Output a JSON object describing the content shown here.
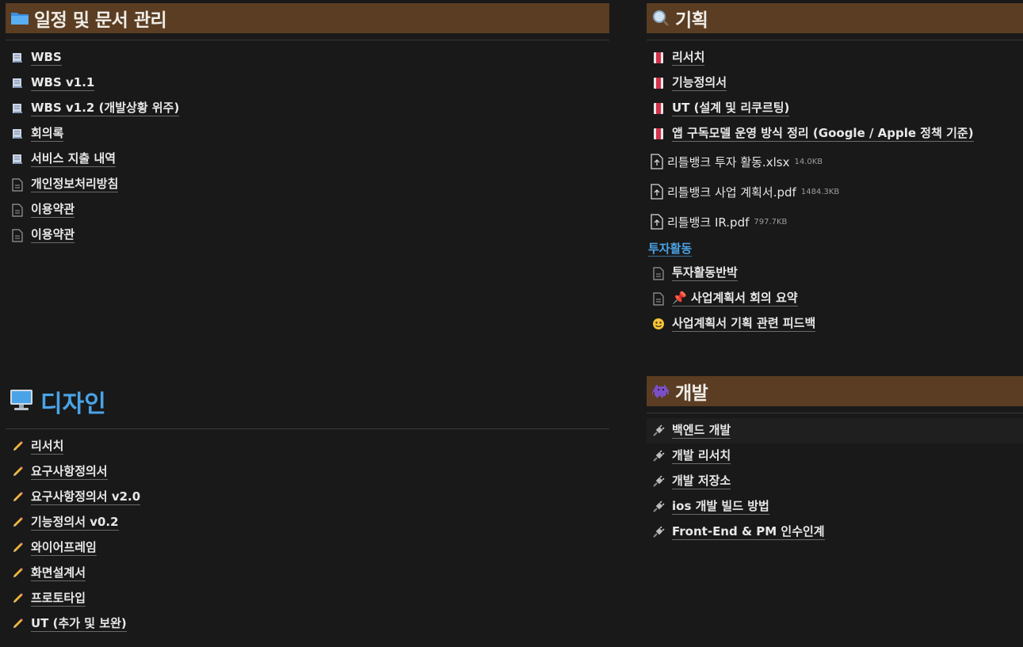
{
  "schedule": {
    "title": "일정 및 문서 관리",
    "items": [
      {
        "label": "WBS",
        "icon": "book-page-icon"
      },
      {
        "label": "WBS v1.1",
        "icon": "book-page-icon"
      },
      {
        "label": "WBS v1.2 (개발상황 위주)",
        "icon": "book-page-icon"
      },
      {
        "label": "회의록",
        "icon": "book-page-icon"
      },
      {
        "label": "서비스 지출 내역",
        "icon": "book-page-icon"
      },
      {
        "label": "개인정보처리방침",
        "icon": "page-icon"
      },
      {
        "label": "이용약관",
        "icon": "page-icon"
      },
      {
        "label": "이용약관",
        "icon": "page-icon"
      }
    ]
  },
  "planning": {
    "title": "기획",
    "items": [
      {
        "label": "리서치",
        "icon": "red-book-icon"
      },
      {
        "label": "기능정의서",
        "icon": "red-book-icon"
      },
      {
        "label": "UT (설계 및 리쿠르팅)",
        "icon": "red-book-icon"
      },
      {
        "label": "앱 구독모델 운영 방식 정리 (Google / Apple 정책 기준)",
        "icon": "red-book-icon"
      }
    ],
    "files": [
      {
        "name": "리틀뱅크 투자 활동.xlsx",
        "size": "14.0KB"
      },
      {
        "name": "리틀뱅크 사업 계획서.pdf",
        "size": "1484.3KB"
      },
      {
        "name": "리틀뱅크 IR.pdf",
        "size": "797.7KB"
      }
    ],
    "group_title": "투자활동",
    "group_items": [
      {
        "label": "투자활동반박",
        "icon": "page-icon"
      },
      {
        "label": "📌 사업계획서 회의 요약",
        "icon": "page-icon"
      },
      {
        "label": "사업계획서 기획 관련 피드백",
        "icon": "smiley-icon"
      }
    ]
  },
  "design": {
    "title": "디자인",
    "items": [
      {
        "label": "리서치"
      },
      {
        "label": "요구사항정의서"
      },
      {
        "label": "요구사항정의서 v2.0"
      },
      {
        "label": "기능정의서 v0.2"
      },
      {
        "label": "와이어프레임"
      },
      {
        "label": "화면설계서"
      },
      {
        "label": "프로토타입"
      },
      {
        "label": "UT (추가 및 보완)"
      }
    ]
  },
  "dev": {
    "title": "개발",
    "items": [
      {
        "label": "백엔드 개발"
      },
      {
        "label": "개발 리서치"
      },
      {
        "label": "개발 저장소"
      },
      {
        "label": "ios 개발 빌드 방법"
      },
      {
        "label": "Front-End & PM 인수인계"
      }
    ]
  },
  "colors": {
    "background": "#191919",
    "header_bg": "#5a3d22",
    "accent_blue": "#4aa3e6"
  }
}
